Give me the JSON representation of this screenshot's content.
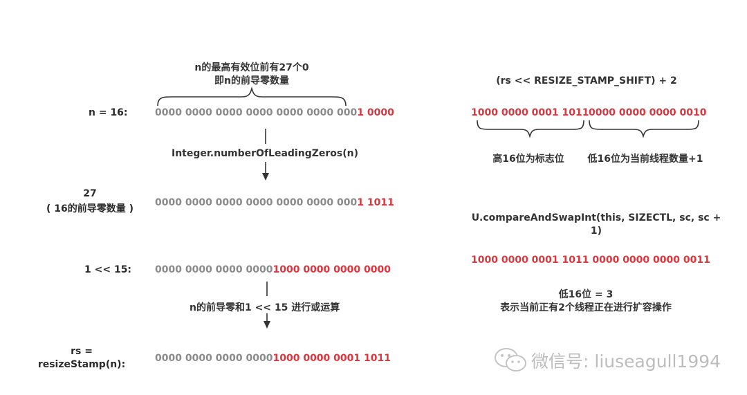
{
  "left": {
    "brace_note_line1": "n的最高有效位前有27个0",
    "brace_note_line2": "即n的前导零数量",
    "row1": {
      "label": "n = 16:",
      "gray": "0000 0000 0000 0000 0000 0000 000",
      "red": "1 0000"
    },
    "op1": "Integer.numberOfLeadingZeros(n)",
    "row2": {
      "label_line1": "27",
      "label_line2": "( 16的前导零数量 )",
      "gray": "0000 0000 0000 0000 0000 0000 000",
      "red": "1 1011"
    },
    "row3": {
      "label": "1 << 15:",
      "gray": "0000 0000 0000 0000",
      "red": "1000 0000 0000 0000"
    },
    "op2": "n的前导零和1 << 15 进行或运算",
    "row4": {
      "label_line1": "rs =",
      "label_line2": "resizeStamp(n):",
      "gray": "0000 0000 0000 0000",
      "red": "1000 0000 0001 1011"
    }
  },
  "right": {
    "expr1": "(rs << RESIZE_STAMP_SHIFT) + 2",
    "bits1_high": "1000 0000 0001 1011",
    "bits1_low": "0000 0000 0000 0010",
    "note_high": "高16位为标志位",
    "note_low": "低16位为当前线程数量+1",
    "expr2_line1": "U.compareAndSwapInt(this, SIZECTL, sc, sc +",
    "expr2_line2": "1)",
    "bits2": "1000 0000 0001 1011 0000 0000 0000 0011",
    "note2_line1": "低16位 = 3",
    "note2_line2": "表示当前正有2个线程正在进行扩容操作"
  },
  "watermark": "微信号: liuseagull1994",
  "colors": {
    "red": "#d9363e",
    "gray": "#8a8a8a",
    "text": "#333333"
  }
}
